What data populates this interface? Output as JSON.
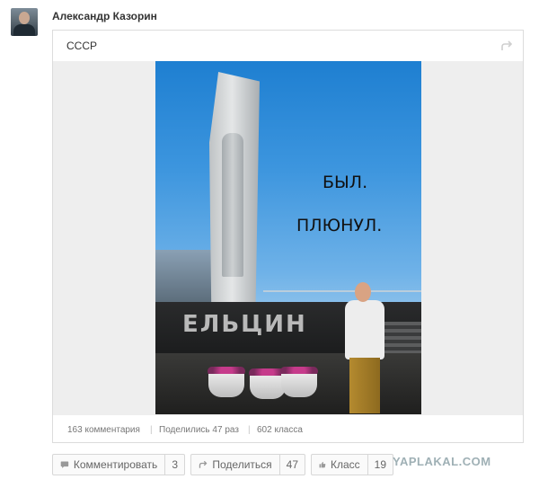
{
  "post": {
    "author": "Александр Казорин",
    "title": "СССР",
    "image_caption_line1": "БЫЛ.",
    "image_caption_line2": "ПЛЮНУЛ.",
    "monument_text": "ЕЛЬЦИН"
  },
  "stats": {
    "comments": "163 комментария",
    "shares": "Поделились 47 раз",
    "likes": "602 класса",
    "separator": "|"
  },
  "actions": {
    "comment_label": "Комментировать",
    "comment_count": "3",
    "share_label": "Поделиться",
    "share_count": "47",
    "like_label": "Класс",
    "like_count": "19"
  },
  "watermark": "YAPLAKAL.COM",
  "icons": {
    "avatar": "user-photo",
    "reshare": "reshare-arrow-icon",
    "comment": "speech-bubble-icon",
    "share": "share-arrow-icon",
    "like": "thumbs-up-icon"
  }
}
